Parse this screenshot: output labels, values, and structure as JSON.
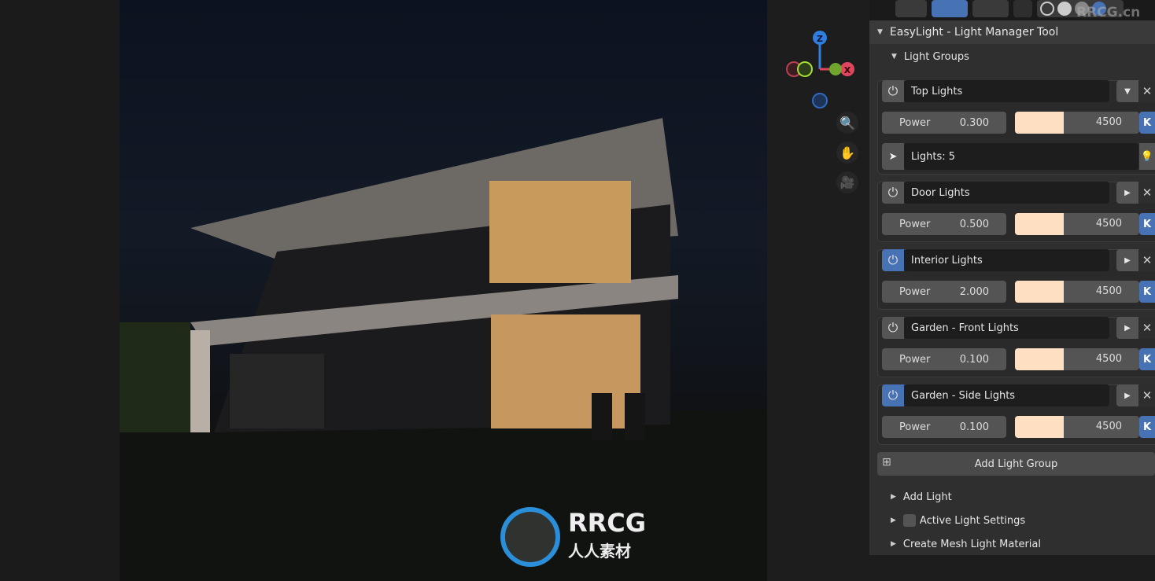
{
  "panel": {
    "title": "EasyLight - Light Manager Tool",
    "section": "Light Groups",
    "groups": [
      {
        "name": "Top Lights",
        "enabled": false,
        "expanded": true,
        "power_label": "Power",
        "power": "0.300",
        "temperature": "4500",
        "lights": "Lights: 5"
      },
      {
        "name": "Door Lights",
        "enabled": false,
        "expanded": false,
        "power_label": "Power",
        "power": "0.500",
        "temperature": "4500"
      },
      {
        "name": "Interior Lights",
        "enabled": true,
        "expanded": false,
        "power_label": "Power",
        "power": "2.000",
        "temperature": "4500"
      },
      {
        "name": "Garden - Front Lights",
        "enabled": false,
        "expanded": false,
        "power_label": "Power",
        "power": "0.100",
        "temperature": "4500"
      },
      {
        "name": "Garden - Side Lights",
        "enabled": true,
        "expanded": false,
        "power_label": "Power",
        "power": "0.100",
        "temperature": "4500"
      }
    ],
    "add_group": "Add Light Group",
    "subpanels": [
      "Add Light",
      "Active Light Settings",
      "Create Mesh Light Material"
    ],
    "k_label": "K"
  },
  "gizmo": {
    "z": "Z",
    "x": "X"
  },
  "colors": {
    "accent": "#4772b3",
    "light_color": "#ffdfc2",
    "panel": "#2f2f2f"
  },
  "watermark": {
    "brand": "RRCG",
    "sub": "人人素材",
    "site": "RRCG.cn"
  }
}
